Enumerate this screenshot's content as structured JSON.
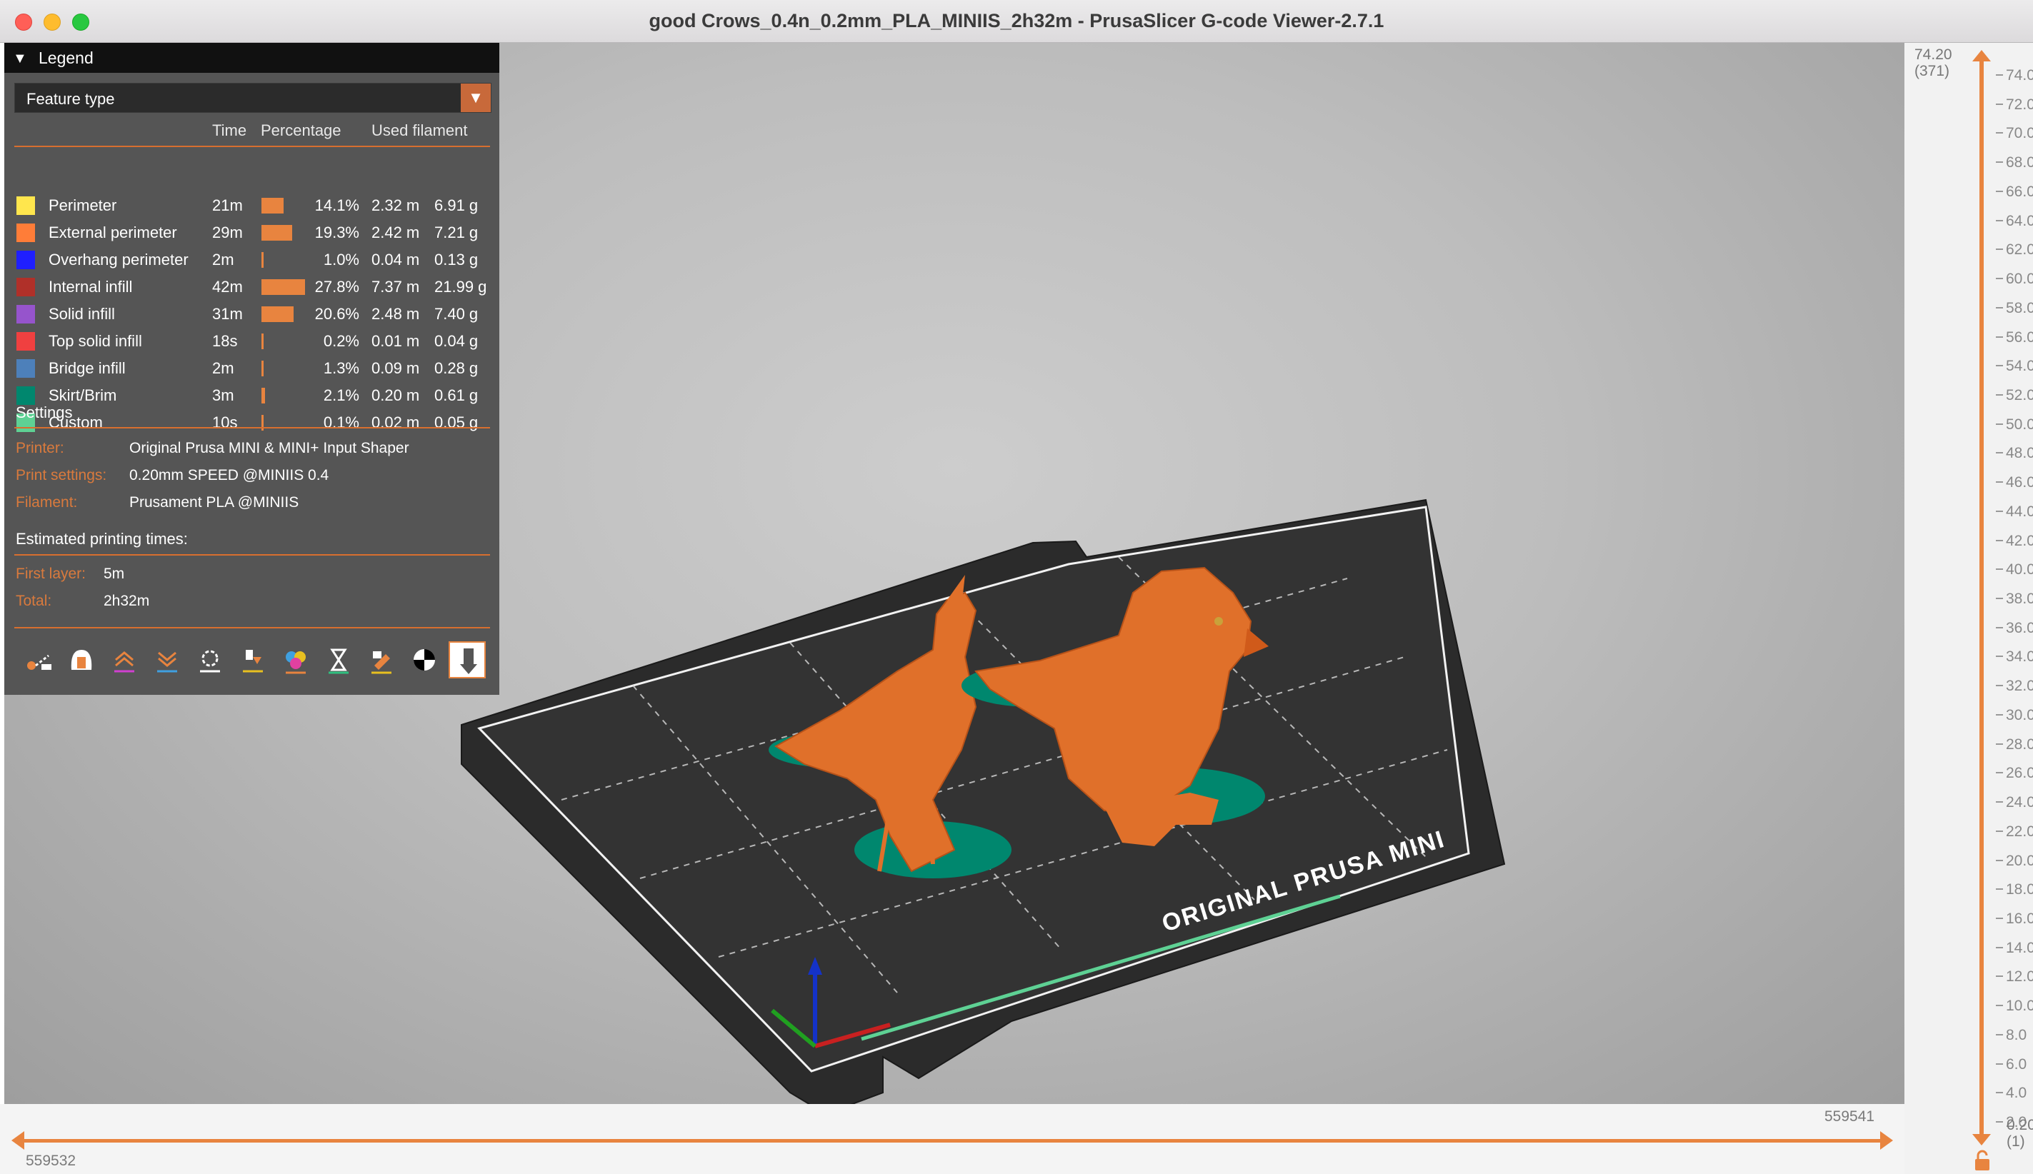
{
  "window": {
    "title": "good Crows_0.4n_0.2mm_PLA_MINIIS_2h32m - PrusaSlicer G-code Viewer-2.7.1"
  },
  "legend": {
    "title": "Legend",
    "view_type": "Feature type",
    "columns": {
      "time": "Time",
      "percentage": "Percentage",
      "used_filament": "Used filament"
    },
    "features": [
      {
        "name": "Perimeter",
        "color": "#ffe64d",
        "time": "21m",
        "percent": "14.1%",
        "fraction": 0.141,
        "length": "2.32 m",
        "weight": "6.91 g"
      },
      {
        "name": "External perimeter",
        "color": "#ff7d38",
        "time": "29m",
        "percent": "19.3%",
        "fraction": 0.193,
        "length": "2.42 m",
        "weight": "7.21 g"
      },
      {
        "name": "Overhang perimeter",
        "color": "#1f1fff",
        "time": "2m",
        "percent": "1.0%",
        "fraction": 0.01,
        "length": "0.04 m",
        "weight": "0.13 g"
      },
      {
        "name": "Internal infill",
        "color": "#b03029",
        "time": "42m",
        "percent": "27.8%",
        "fraction": 0.278,
        "length": "7.37 m",
        "weight": "21.99 g"
      },
      {
        "name": "Solid infill",
        "color": "#9654cc",
        "time": "31m",
        "percent": "20.6%",
        "fraction": 0.206,
        "length": "2.48 m",
        "weight": "7.40 g"
      },
      {
        "name": "Top solid infill",
        "color": "#f04040",
        "time": "18s",
        "percent": "0.2%",
        "fraction": 0.002,
        "length": "0.01 m",
        "weight": "0.04 g"
      },
      {
        "name": "Bridge infill",
        "color": "#4d80ba",
        "time": "2m",
        "percent": "1.3%",
        "fraction": 0.013,
        "length": "0.09 m",
        "weight": "0.28 g"
      },
      {
        "name": "Skirt/Brim",
        "color": "#00876e",
        "time": "3m",
        "percent": "2.1%",
        "fraction": 0.021,
        "length": "0.20 m",
        "weight": "0.61 g"
      },
      {
        "name": "Custom",
        "color": "#5ed194",
        "time": "10s",
        "percent": "0.1%",
        "fraction": 0.001,
        "length": "0.02 m",
        "weight": "0.05 g"
      }
    ],
    "settings": {
      "heading": "Settings",
      "printer_label": "Printer:",
      "printer": "Original Prusa MINI & MINI+ Input Shaper",
      "print_settings_label": "Print settings:",
      "print_settings": "0.20mm SPEED @MINIIS 0.4",
      "filament_label": "Filament:",
      "filament": "Prusament PLA @MINIIS"
    },
    "times": {
      "heading": "Estimated printing times:",
      "first_layer_label": "First layer:",
      "first_layer": "5m",
      "total_label": "Total:",
      "total": "2h32m"
    },
    "toolbar": [
      {
        "icon": "travel-icon"
      },
      {
        "icon": "wipe-icon"
      },
      {
        "icon": "retractions-icon"
      },
      {
        "icon": "deretractions-icon"
      },
      {
        "icon": "seams-icon"
      },
      {
        "icon": "tool-changes-icon"
      },
      {
        "icon": "color-changes-icon"
      },
      {
        "icon": "pause-prints-icon"
      },
      {
        "icon": "custom-gcodes-icon"
      },
      {
        "icon": "center-of-gravity-icon"
      },
      {
        "icon": "shells-icon"
      }
    ]
  },
  "bed": {
    "label": "ORIGINAL PRUSA MINI"
  },
  "vertical_slider": {
    "top_height": "74.20",
    "top_layer": "(371)",
    "bottom_height": "0.20",
    "bottom_layer": "(1)",
    "ruler_labels": [
      "74.0",
      "72.0",
      "70.0",
      "68.0",
      "66.0",
      "64.0",
      "62.0",
      "60.0",
      "58.0",
      "56.0",
      "54.0",
      "52.0",
      "50.0",
      "48.0",
      "46.0",
      "44.0",
      "42.0",
      "40.0",
      "38.0",
      "36.0",
      "34.0",
      "32.0",
      "30.0",
      "28.0",
      "26.0",
      "24.0",
      "22.0",
      "20.0",
      "18.0",
      "16.0",
      "14.0",
      "12.0",
      "10.0",
      "8.0",
      "6.0",
      "4.0",
      "2.0"
    ]
  },
  "horizontal_slider": {
    "left_value": "559532",
    "right_value": "559541"
  },
  "colors": {
    "accent": "#e8843f",
    "model": "#e0702a",
    "brim": "#00876e"
  }
}
